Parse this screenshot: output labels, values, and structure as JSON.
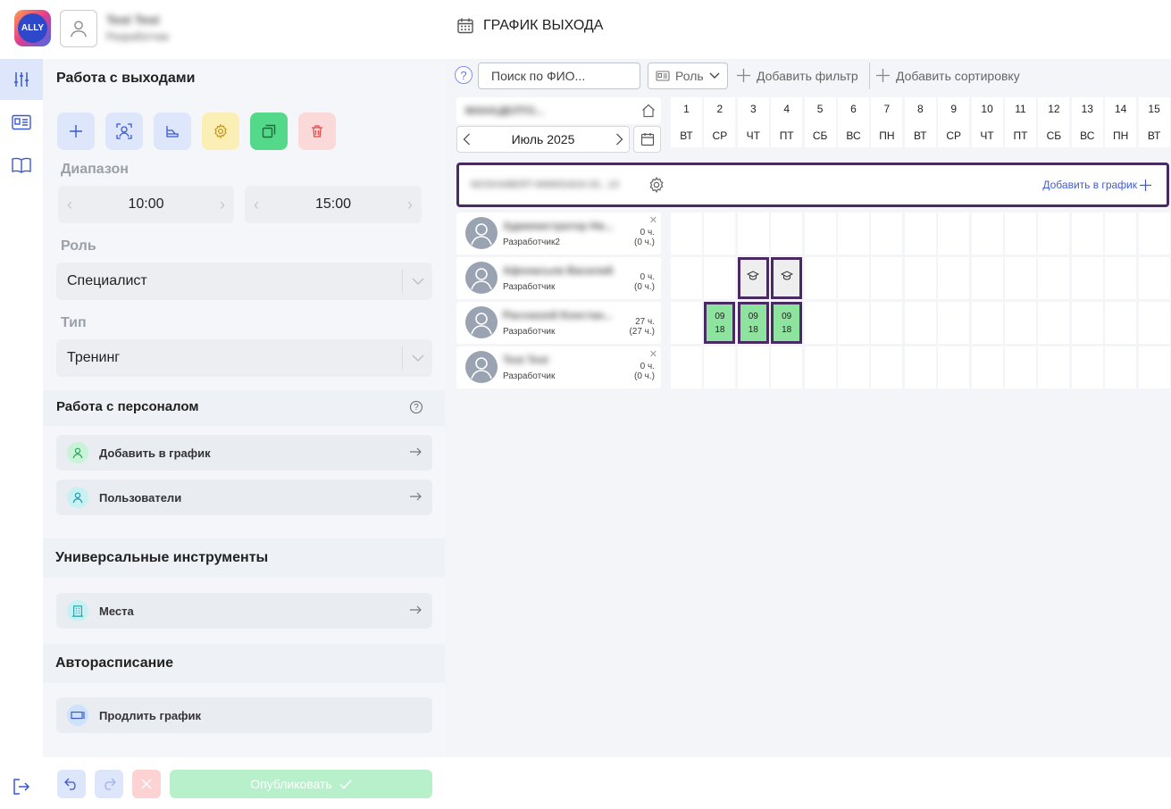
{
  "header": {
    "logo_text": "ALLY",
    "logo_sub": "soft",
    "user_name": "Test Test",
    "user_role": "Разработчик",
    "page_title": "ГРАФИК ВЫХОДА"
  },
  "sidebar": {
    "work_section_title": "Работа с выходами",
    "range_label": "Диапазон",
    "range_from": "10:00",
    "range_to": "15:00",
    "role_label": "Роль",
    "role_value": "Специалист",
    "type_label": "Тип",
    "type_value": "Тренинг",
    "staff_section_title": "Работа с персоналом",
    "staff_items": [
      {
        "label": "Добавить в график",
        "icon": "user-icon"
      },
      {
        "label": "Пользователи",
        "icon": "user-icon"
      }
    ],
    "tools_section_title": "Универсальные инструменты",
    "tools_items": [
      {
        "label": "Места",
        "icon": "building-icon"
      }
    ],
    "auto_section_title": "Авторасписание",
    "auto_items": [
      {
        "label": "Продлить график",
        "icon": "extend-icon"
      }
    ],
    "publish_label": "Опубликовать"
  },
  "toolbar": {
    "help": "?",
    "search_placeholder": "Поиск по ФИО...",
    "role_filter_label": "Роль",
    "add_filter_label": "Добавить фильтр",
    "add_sort_label": "Добавить сортировку"
  },
  "calendar": {
    "department": "МАНАДЕЛТО...",
    "month": "Июль 2025",
    "days": [
      {
        "n": "1",
        "w": "ВТ"
      },
      {
        "n": "2",
        "w": "СР"
      },
      {
        "n": "3",
        "w": "ЧТ"
      },
      {
        "n": "4",
        "w": "ПТ"
      },
      {
        "n": "5",
        "w": "СБ"
      },
      {
        "n": "6",
        "w": "ВС"
      },
      {
        "n": "7",
        "w": "ПН"
      },
      {
        "n": "8",
        "w": "ВТ"
      },
      {
        "n": "9",
        "w": "СР"
      },
      {
        "n": "10",
        "w": "ЧТ"
      },
      {
        "n": "11",
        "w": "ПТ"
      },
      {
        "n": "12",
        "w": "СБ"
      },
      {
        "n": "13",
        "w": "ВС"
      },
      {
        "n": "14",
        "w": "ПН"
      },
      {
        "n": "15",
        "w": "ВТ"
      }
    ],
    "group_name": "MOSHABERT-MMMSADA 00...10",
    "add_to_schedule_label": "Добавить в график",
    "employees": [
      {
        "name": "Администратор Ни...",
        "role": "Разработчик2",
        "hours": "0 ч.",
        "hours_sub": "(0 ч.)",
        "removable": true
      },
      {
        "name": "Афонасьев Василий",
        "role": "Разработчик",
        "hours": "0 ч.",
        "hours_sub": "(0 ч.)",
        "removable": false
      },
      {
        "name": "Рассказой Констан...",
        "role": "Разработчик",
        "hours": "27 ч.",
        "hours_sub": "(27 ч.)",
        "removable": false
      },
      {
        "name": "Test Test",
        "role": "Разработчик",
        "hours": "0 ч.",
        "hours_sub": "(0 ч.)",
        "removable": true
      }
    ],
    "shifts": [
      {
        "emp": 1,
        "day": 3,
        "kind": "training"
      },
      {
        "emp": 1,
        "day": 4,
        "kind": "training"
      },
      {
        "emp": 2,
        "day": 2,
        "kind": "work",
        "start": "09",
        "end": "18"
      },
      {
        "emp": 2,
        "day": 3,
        "kind": "work",
        "start": "09",
        "end": "18"
      },
      {
        "emp": 2,
        "day": 4,
        "kind": "work",
        "start": "09",
        "end": "18"
      }
    ]
  },
  "colors": {
    "accent": "#4a2a63",
    "work_shift": "#8ee39f",
    "link_blue": "#3f5bd8"
  }
}
